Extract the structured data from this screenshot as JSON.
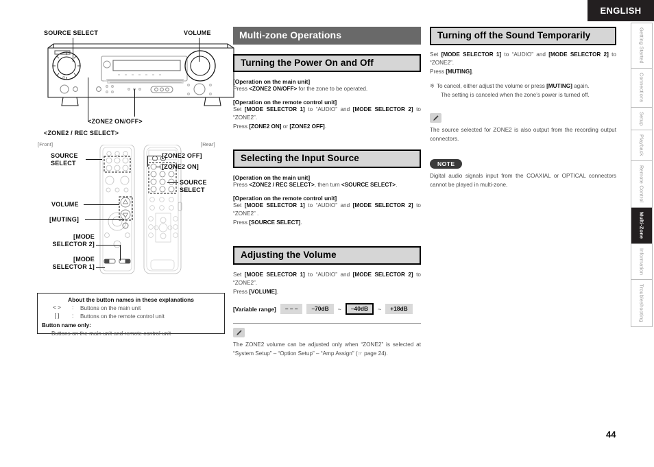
{
  "header": {
    "language": "ENGLISH",
    "page_number": "44"
  },
  "tabs": [
    {
      "label": "Getting Started",
      "active": false
    },
    {
      "label": "Connections",
      "active": false
    },
    {
      "label": "Setup",
      "active": false
    },
    {
      "label": "Playback",
      "active": false
    },
    {
      "label": "Remote Control",
      "active": false
    },
    {
      "label": "Multi-Zone",
      "active": true
    },
    {
      "label": "Information",
      "active": false
    },
    {
      "label": "Troubleshooting",
      "active": false
    }
  ],
  "illustration": {
    "main_unit": {
      "source_select": "SOURCE SELECT",
      "volume": "VOLUME",
      "zone2_onoff": "<ZONE2 ON/OFF>",
      "zone2_rec_select": "<ZONE2 / REC SELECT>"
    },
    "remote": {
      "front_caption": "[Front]",
      "rear_caption": "[Rear]",
      "source_select_front": "SOURCE\nSELECT",
      "volume": "VOLUME",
      "muting": "[MUTING]",
      "mode_selector_2": "[MODE\nSELECTOR 2]",
      "mode_selector_1": "[MODE\nSELECTOR 1]",
      "zone2_off": "[ZONE2 OFF]",
      "zone2_on": "[ZONE2 ON]",
      "source_select_rear": "SOURCE\nSELECT"
    }
  },
  "about_box": {
    "title": "About the button names in these explanations",
    "rows": [
      {
        "key": "<    >",
        "colon": ":",
        "text": "Buttons on the main unit"
      },
      {
        "key": "[    ]",
        "colon": ":",
        "text": "Buttons on the remote control unit"
      }
    ],
    "only_label": "Button name only:",
    "only_text": "Buttons on the main unit and remote control unit"
  },
  "main": {
    "chapter_title": "Multi-zone Operations",
    "sections": [
      {
        "title": "Turning the Power On and Off",
        "main_unit_label": "[Operation on the main unit]",
        "main_unit_text_pre": "Press ",
        "main_unit_bold": "<ZONE2 ON/OFF>",
        "main_unit_text_post": " for the zone to be operated.",
        "remote_label": "[Operation on the remote control unit]",
        "remote_line1_a": "Set ",
        "remote_line1_b": "[MODE SELECTOR 1]",
        "remote_line1_c": " to “AUDIO” and ",
        "remote_line1_d": "[MODE SELECTOR 2]",
        "remote_line1_e": " to “ZONE2”.",
        "remote_line2_a": "Press ",
        "remote_line2_b": "[ZONE2 ON]",
        "remote_line2_c": " or ",
        "remote_line2_d": "[ZONE2 OFF]",
        "remote_line2_e": "."
      },
      {
        "title": "Selecting the Input Source",
        "main_unit_label": "[Operation on the main unit]",
        "main_unit_text_pre": "Press ",
        "main_unit_bold": "<ZONE2 / REC SELECT>",
        "main_unit_mid": ", then turn ",
        "main_unit_bold2": "<SOURCE SELECT>",
        "main_unit_text_post": ".",
        "remote_label": "[Operation on the remote control unit]",
        "remote_line1_a": "Set ",
        "remote_line1_b": "[MODE SELECTOR 1]",
        "remote_line1_c": " to “AUDIO” and ",
        "remote_line1_d": "[MODE SELECTOR 2]",
        "remote_line1_e": " to “ZONE2” .",
        "remote_line2_a": "Press ",
        "remote_line2_b": "[SOURCE SELECT]",
        "remote_line2_c": "."
      },
      {
        "title": "Adjusting the Volume",
        "line1_a": "Set ",
        "line1_b": "[MODE SELECTOR 1]",
        "line1_c": " to “AUDIO” and ",
        "line1_d": "[MODE SELECTOR 2]",
        "line1_e": " to “ZONE2”.",
        "line2_a": "Press ",
        "line2_b": "[VOLUME]",
        "line2_c": ".",
        "variable_range_label": "[Variable range]",
        "variable_range_chips": [
          "– – –",
          "–70dB",
          "–40dB",
          "+18dB"
        ],
        "tilde": "~",
        "memo_icon": "pencil-icon",
        "memo_text": "The ZONE2 volume can be adjusted only when “ZONE2” is selected at “System Setup” – “Option Setup” – “Amp Assign” (☞ page 24)."
      }
    ]
  },
  "right": {
    "section_title": "Turning off the Sound Temporarily",
    "line1_a": "Set ",
    "line1_b": "[MODE SELECTOR 1]",
    "line1_c": " to “AUDIO” and ",
    "line1_d": "[MODE SELECTOR 2]",
    "line1_e": " to “ZONE2”.",
    "line2_a": "Press ",
    "line2_b": "[MUTING]",
    "line2_c": ".",
    "bullet_mark": "※",
    "bullet_a": "To cancel, either adjust the volume or press ",
    "bullet_b": "[MUTING]",
    "bullet_c": " again.",
    "bullet_line2": "The setting is canceled when the zone’s power is turned off.",
    "memo_icon": "pencil-icon",
    "memo_text": "The source selected for ZONE2 is also output from the recording output connectors.",
    "note_label": "NOTE",
    "note_text": "Digital audio signals input from the COAXIAL or OPTICAL connectors cannot be played in multi-zone."
  }
}
